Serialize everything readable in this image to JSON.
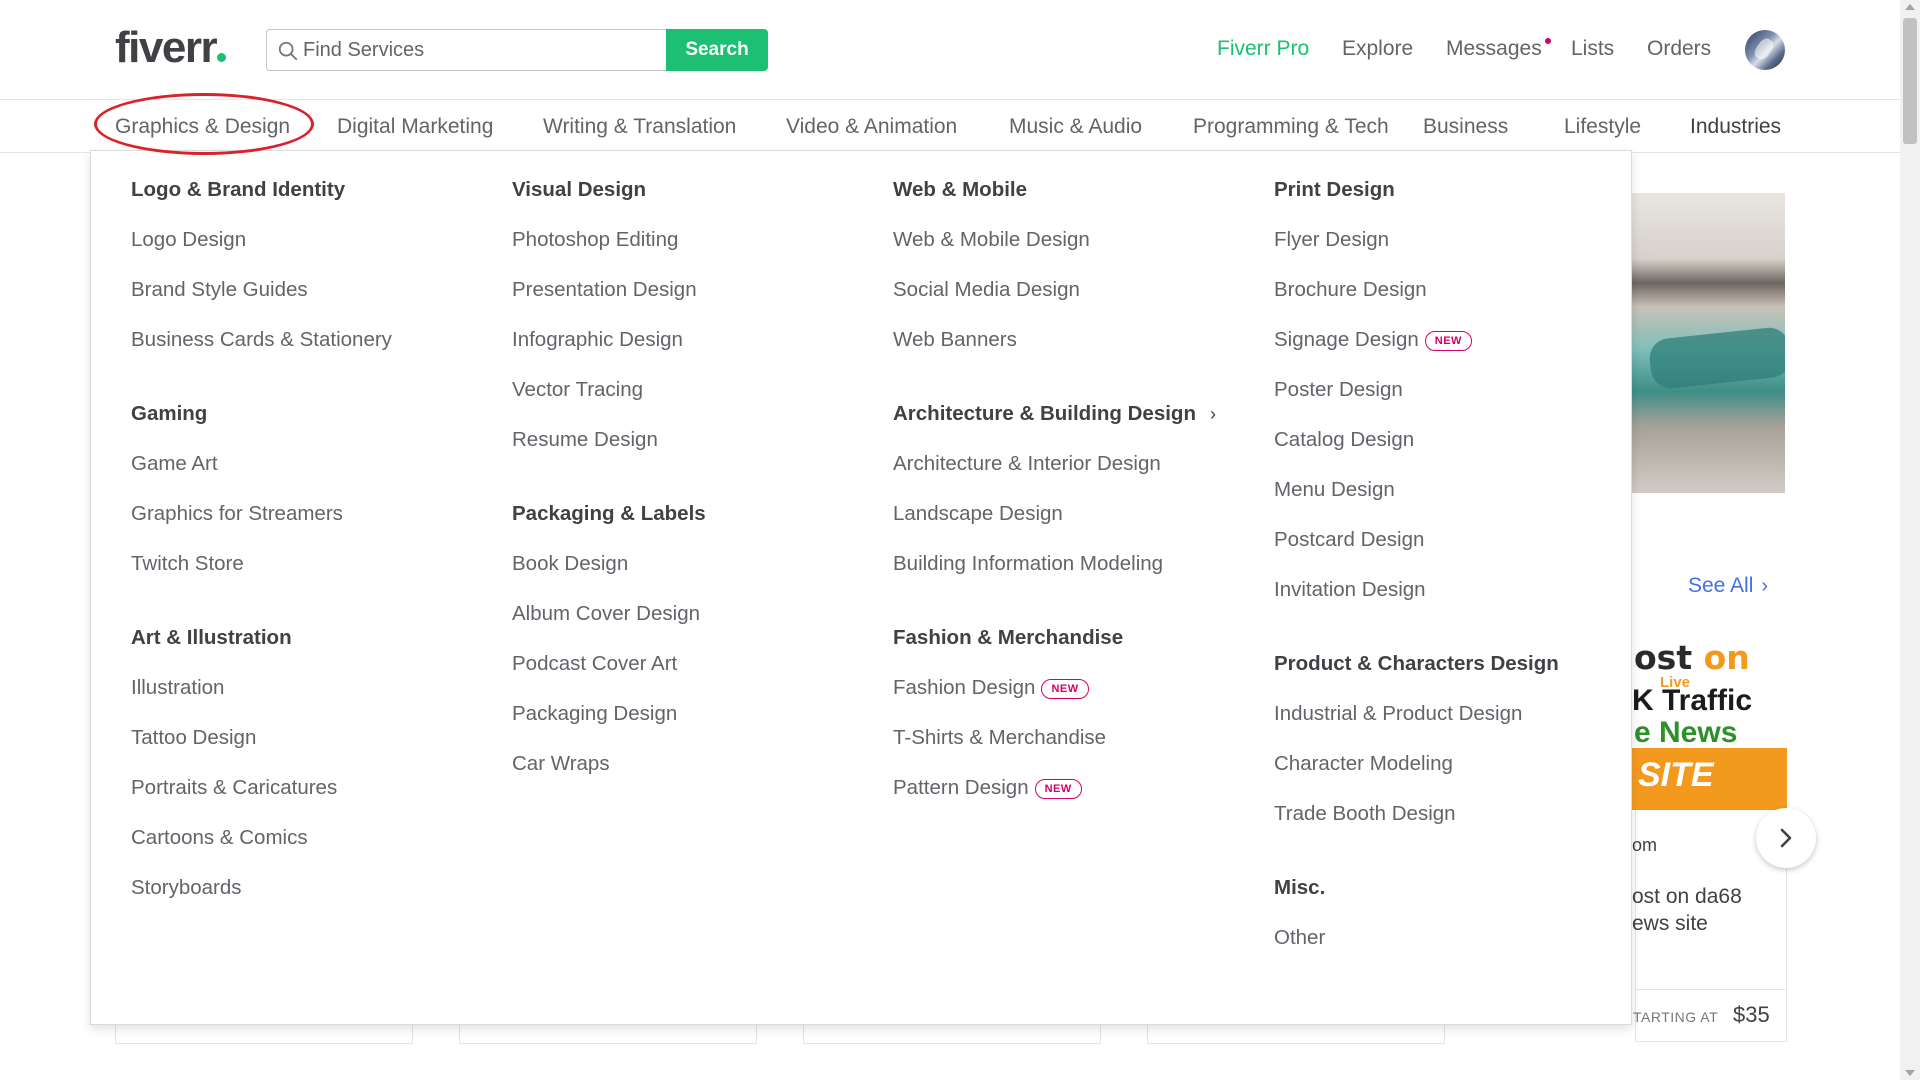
{
  "header": {
    "logo_text": "fiverr",
    "search": {
      "placeholder": "Find Services",
      "value": "",
      "button_label": "Search",
      "icon": "search-icon"
    },
    "nav": {
      "fiverr_pro": "Fiverr Pro",
      "explore": "Explore",
      "messages": "Messages",
      "lists": "Lists",
      "orders": "Orders"
    },
    "avatar_icon": "user-avatar"
  },
  "categories": [
    "Graphics & Design",
    "Digital Marketing",
    "Writing & Translation",
    "Video & Animation",
    "Music & Audio",
    "Programming & Tech",
    "Business",
    "Lifestyle",
    "Industries"
  ],
  "active_category": "Graphics & Design",
  "dropdown": {
    "col1": {
      "logo_brand": {
        "title": "Logo & Brand Identity",
        "items": [
          "Logo Design",
          "Brand Style Guides",
          "Business Cards & Stationery"
        ]
      },
      "gaming": {
        "title": "Gaming",
        "items": [
          "Game Art",
          "Graphics for Streamers",
          "Twitch Store"
        ]
      },
      "art": {
        "title": "Art & Illustration",
        "items": [
          "Illustration",
          "Tattoo Design",
          "Portraits & Caricatures",
          "Cartoons & Comics",
          "Storyboards"
        ]
      }
    },
    "col2": {
      "visual": {
        "title": "Visual Design",
        "items": [
          "Photoshop Editing",
          "Presentation Design",
          "Infographic Design",
          "Vector Tracing",
          "Resume Design"
        ]
      },
      "packaging": {
        "title": "Packaging & Labels",
        "items": [
          "Book Design",
          "Album Cover Design",
          "Podcast Cover Art",
          "Packaging Design",
          "Car Wraps"
        ]
      }
    },
    "col3": {
      "web": {
        "title": "Web & Mobile",
        "items": [
          "Web & Mobile Design",
          "Social Media Design",
          "Web Banners"
        ]
      },
      "arch": {
        "title": "Architecture & Building Design",
        "chevron": "›",
        "items": [
          "Architecture & Interior Design",
          "Landscape Design",
          "Building Information Modeling"
        ]
      },
      "fashion": {
        "title": "Fashion & Merchandise",
        "items": [
          "Fashion Design",
          "T-Shirts & Merchandise",
          "Pattern Design"
        ]
      }
    },
    "col4": {
      "print": {
        "title": "Print Design",
        "items": [
          "Flyer Design",
          "Brochure Design",
          "Signage Design",
          "Poster Design",
          "Catalog Design",
          "Menu Design",
          "Postcard Design",
          "Invitation Design"
        ]
      },
      "product": {
        "title": "Product & Characters Design",
        "items": [
          "Industrial & Product Design",
          "Character Modeling",
          "Trade Booth Design"
        ]
      },
      "misc": {
        "title": "Misc.",
        "items": [
          "Other"
        ]
      }
    },
    "new_badge": "NEW"
  },
  "background": {
    "see_all": "See All",
    "card": {
      "image_text": {
        "line1_a": "ost ",
        "line1_b": "on",
        "live": "Live",
        "line2": "K Traffic",
        "line3": "e News",
        "line4": "SITE"
      },
      "seller": "om",
      "title_line1": "ost on da68",
      "title_line2": "ews site",
      "starting_at": "TARTING AT",
      "price": "$35"
    }
  },
  "colors": {
    "brand_green": "#1dbf73",
    "text_dark": "#404145",
    "text_gray": "#62646a",
    "link_blue": "#446ee7",
    "badge_pink": "#d50066",
    "annotation_red": "#d9232c"
  }
}
